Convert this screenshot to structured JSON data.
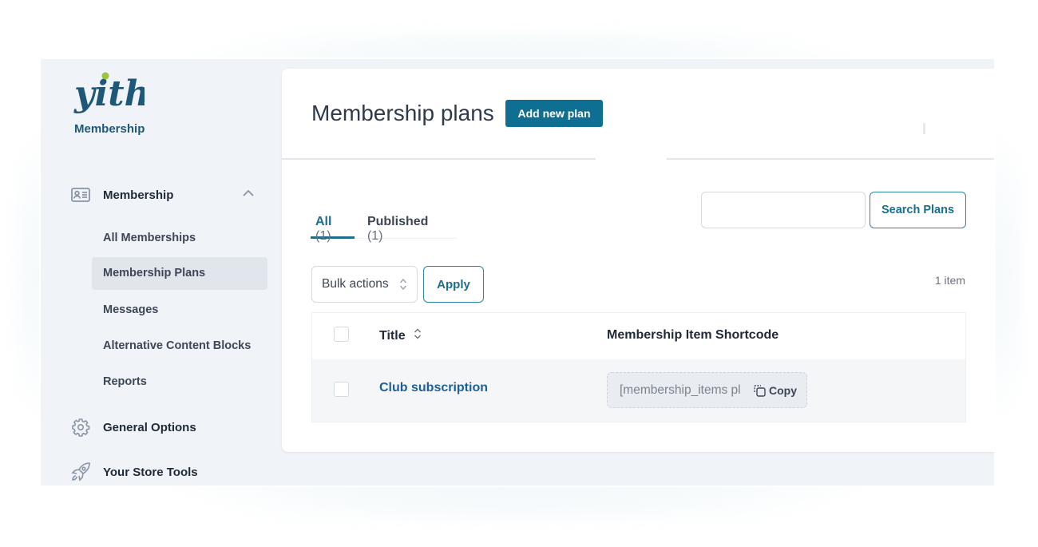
{
  "brand": {
    "logo_text": "yith",
    "subtitle": "Membership",
    "colors": {
      "logo": "#1d5878",
      "logo_dot": "#9bc53d",
      "accent": "#0f6f93"
    }
  },
  "sidebar": {
    "sections": [
      {
        "label": "Membership",
        "icon": "id-card-icon",
        "expanded": true
      },
      {
        "label": "General Options",
        "icon": "gear-icon"
      },
      {
        "label": "Your Store Tools",
        "icon": "rocket-icon"
      }
    ],
    "sub_items": [
      {
        "label": "All Memberships",
        "active": false
      },
      {
        "label": "Membership Plans",
        "active": true
      },
      {
        "label": "Messages",
        "active": false
      },
      {
        "label": "Alternative Content Blocks",
        "active": false
      },
      {
        "label": "Reports",
        "active": false
      }
    ]
  },
  "main": {
    "title": "Membership plans",
    "add_button": "Add new plan",
    "tabs": [
      {
        "label": "All",
        "count": "(1)",
        "active": true
      },
      {
        "label": "Published",
        "count": "(1)",
        "active": false
      }
    ],
    "search": {
      "value": "",
      "placeholder": "",
      "button": "Search Plans"
    },
    "bulk_actions": {
      "selected": "Bulk actions",
      "apply": "Apply"
    },
    "items_count": "1 item",
    "table": {
      "columns": [
        "Title",
        "Membership Item Shortcode"
      ],
      "rows": [
        {
          "title": "Club subscription",
          "shortcode": "[membership_items pl",
          "copy_label": "Copy"
        }
      ]
    }
  }
}
